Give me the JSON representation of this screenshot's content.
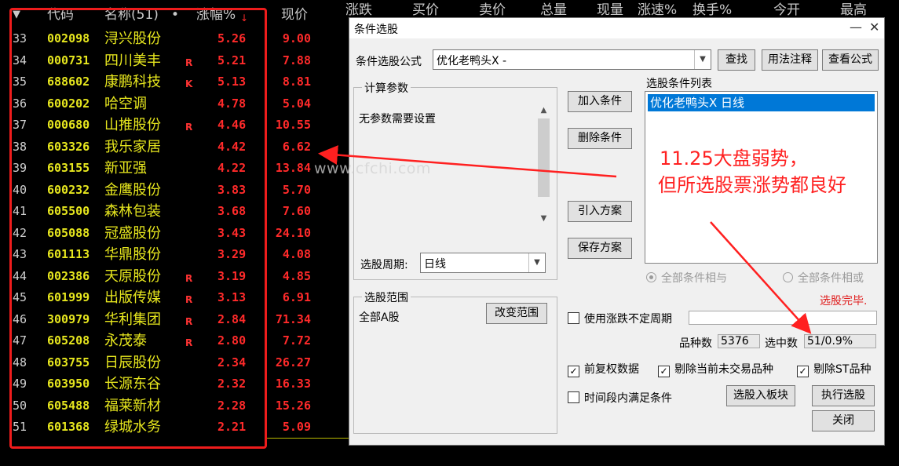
{
  "table": {
    "headers": {
      "sort": "▼",
      "code": "代码",
      "name": "名称(51)",
      "dot": "•",
      "change_pct": "涨幅%",
      "price": "现价",
      "change": "涨跌",
      "bid": "买价",
      "ask": "卖价",
      "volume": "总量",
      "cur_vol": "现量",
      "speed": "涨速%",
      "turnover": "换手%",
      "open": "今开",
      "high": "最高"
    },
    "rows": [
      {
        "idx": "33",
        "code": "002098",
        "name": "浔兴股份",
        "flag": "",
        "pct": "5.26",
        "price": "9.00"
      },
      {
        "idx": "34",
        "code": "000731",
        "name": "四川美丰",
        "flag": "R",
        "pct": "5.21",
        "price": "7.88"
      },
      {
        "idx": "35",
        "code": "688602",
        "name": "康鹏科技",
        "flag": "K",
        "pct": "5.13",
        "price": "8.81"
      },
      {
        "idx": "36",
        "code": "600202",
        "name": "哈空调",
        "flag": "",
        "pct": "4.78",
        "price": "5.04"
      },
      {
        "idx": "37",
        "code": "000680",
        "name": "山推股份",
        "flag": "R",
        "pct": "4.46",
        "price": "10.55"
      },
      {
        "idx": "38",
        "code": "603326",
        "name": "我乐家居",
        "flag": "",
        "pct": "4.42",
        "price": "6.62"
      },
      {
        "idx": "39",
        "code": "603155",
        "name": "新亚强",
        "flag": "",
        "pct": "4.22",
        "price": "13.84"
      },
      {
        "idx": "40",
        "code": "600232",
        "name": "金鹰股份",
        "flag": "",
        "pct": "3.83",
        "price": "5.70"
      },
      {
        "idx": "41",
        "code": "605500",
        "name": "森林包装",
        "flag": "",
        "pct": "3.68",
        "price": "7.60"
      },
      {
        "idx": "42",
        "code": "605088",
        "name": "冠盛股份",
        "flag": "",
        "pct": "3.43",
        "price": "24.10"
      },
      {
        "idx": "43",
        "code": "601113",
        "name": "华鼎股份",
        "flag": "",
        "pct": "3.29",
        "price": "4.08"
      },
      {
        "idx": "44",
        "code": "002386",
        "name": "天原股份",
        "flag": "R",
        "pct": "3.19",
        "price": "4.85"
      },
      {
        "idx": "45",
        "code": "601999",
        "name": "出版传媒",
        "flag": "R",
        "pct": "3.13",
        "price": "6.91"
      },
      {
        "idx": "46",
        "code": "300979",
        "name": "华利集团",
        "flag": "R",
        "pct": "2.84",
        "price": "71.34"
      },
      {
        "idx": "47",
        "code": "605208",
        "name": "永茂泰",
        "flag": "R",
        "pct": "2.80",
        "price": "7.72"
      },
      {
        "idx": "48",
        "code": "603755",
        "name": "日辰股份",
        "flag": "",
        "pct": "2.34",
        "price": "26.27"
      },
      {
        "idx": "49",
        "code": "603950",
        "name": "长源东谷",
        "flag": "",
        "pct": "2.32",
        "price": "16.33"
      },
      {
        "idx": "50",
        "code": "605488",
        "name": "福莱新材",
        "flag": "",
        "pct": "2.28",
        "price": "15.26"
      },
      {
        "idx": "51",
        "code": "601368",
        "name": "绿城水务",
        "flag": "",
        "pct": "2.21",
        "price": "5.09"
      }
    ]
  },
  "dialog": {
    "title": "条件选股",
    "min_label": "—",
    "close_label": "✕",
    "formula_label": "条件选股公式",
    "formula_value": "优化老鸭头X  -",
    "find_button": "查找",
    "usage_button": "用法注释",
    "view_formula_button": "查看公式",
    "params_group": "计算参数",
    "params_text": "无参数需要设置",
    "period_label": "选股周期:",
    "period_value": "日线",
    "add_condition": "加入条件",
    "delete_condition": "删除条件",
    "import_plan": "引入方案",
    "save_plan": "保存方案",
    "condition_list_label": "选股条件列表",
    "condition_list_items": [
      "优化老鸭头X  日线"
    ],
    "radio_and": "全部条件相与",
    "radio_or": "全部条件相或",
    "status": "选股完毕.",
    "scope_group": "选股范围",
    "scope_value": "全部A股",
    "change_scope": "改变范围",
    "use_variable_period": "使用涨跌不定周期",
    "variable_period_value": "",
    "count_label": "品种数",
    "count_value": "5376",
    "selected_label": "选中数",
    "selected_value": "51/0.9%",
    "check_pre_adjust": "前复权数据",
    "check_remove_untraded": "剔除当前未交易品种",
    "check_remove_st": "剔除ST品种",
    "check_period_satisfy": "时间段内满足条件",
    "select_to_board": "选股入板块",
    "run_select": "执行选股",
    "close_button": "关闭",
    "checks": {
      "pre_adjust": true,
      "remove_untraded": true,
      "remove_st": true,
      "period_satisfy": false,
      "variable_period": false
    }
  },
  "annotations": {
    "line1": "11.25大盘弱势，",
    "line2": "但所选股票涨势都良好",
    "watermark": "www.cfchi.com",
    "color": "#ff2020"
  },
  "colors": {
    "highlight_box": "#ee1c1c",
    "stock_text": "#e6e61e",
    "up_red": "#ff2a2a",
    "selection_blue": "#0078d7"
  }
}
